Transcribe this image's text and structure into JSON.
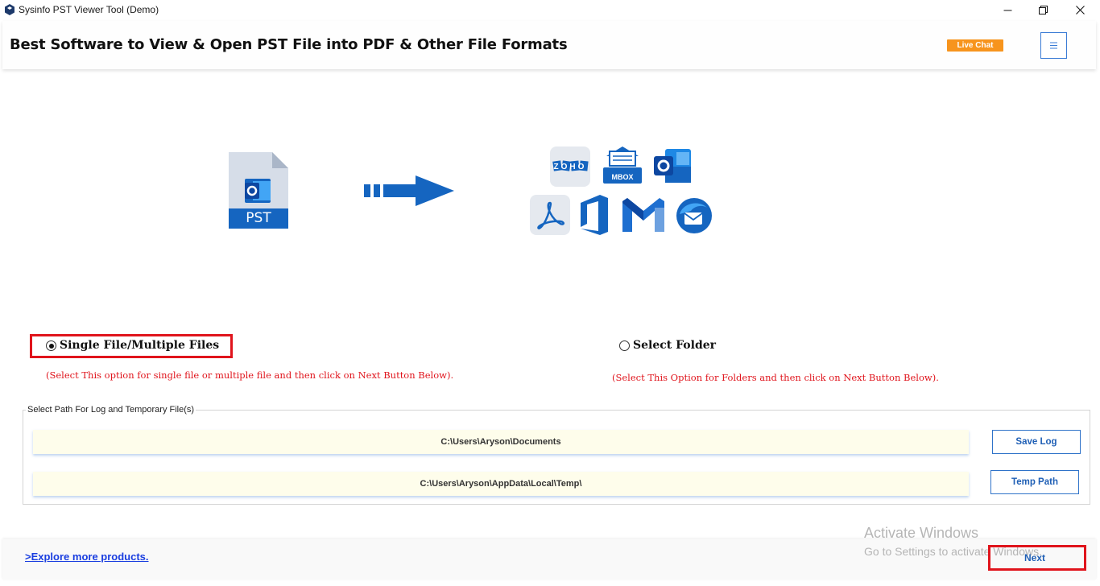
{
  "window": {
    "title": "Sysinfo PST Viewer Tool (Demo)",
    "controls": [
      "minimize-icon",
      "restore-icon",
      "close-icon"
    ]
  },
  "header": {
    "heading": "Best Software to View & Open PST File into PDF & Other File Formats",
    "live_chat_label": "Live Chat",
    "menu_icon": "hamburger-menu-icon"
  },
  "illustration": {
    "source_file_label": "PST",
    "target_icons": [
      "zoho-icon",
      "mbox-icon",
      "outlook-icon",
      "pdf-icon",
      "office-icon",
      "gmail-icon",
      "thunderbird-icon"
    ],
    "mbox_label": "MBOX",
    "zoho_label": "ZOHO"
  },
  "options": {
    "single": {
      "label": "Single File/Multiple Files",
      "hint": "(Select This option for single file or multiple file and then click on Next Button Below).",
      "selected": true
    },
    "folder": {
      "label": "Select Folder",
      "hint": "(Select This Option for Folders and then click on Next Button Below).",
      "selected": false
    }
  },
  "paths": {
    "group_label": "Select Path For Log and Temporary File(s)",
    "log_path": "C:\\Users\\Aryson\\Documents",
    "temp_path": "C:\\Users\\Aryson\\AppData\\Local\\Temp\\",
    "save_log_label": "Save Log",
    "temp_path_label": "Temp Path"
  },
  "footer": {
    "explore_link": ">Explore more products.",
    "next_label": "Next"
  },
  "watermark": {
    "title": "Activate Windows",
    "subtitle": "Go to Settings to activate Windows."
  },
  "colors": {
    "accent_blue": "#1f5fb5",
    "highlight_red": "#e0141c",
    "live_chat_orange": "#f7941d",
    "path_field_bg": "#fefdeb"
  }
}
